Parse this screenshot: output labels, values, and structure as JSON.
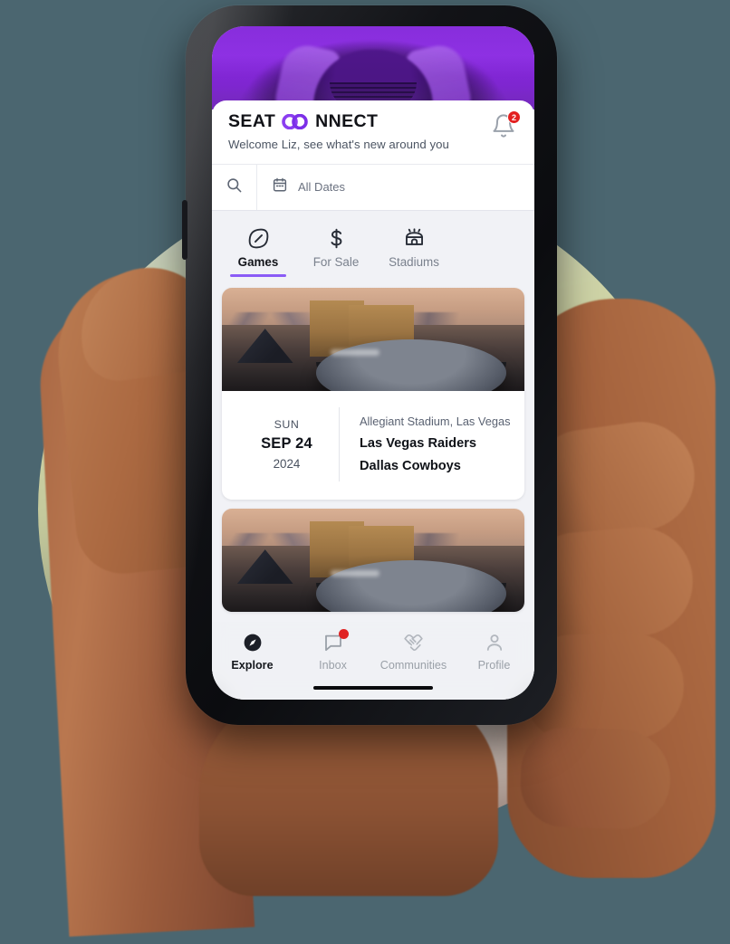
{
  "app": {
    "logo_word1": "SEAT",
    "logo_mark": "infinity-mark",
    "logo_word2": "NNECT",
    "welcome": "Welcome Liz, see what's new around you",
    "accent_purple": "#8b5cf6",
    "badge_red": "#e32020",
    "page_background": "#4b6670"
  },
  "header": {
    "notification_icon": "bell-icon",
    "notification_count": "2"
  },
  "search": {
    "search_icon": "search-icon",
    "calendar_icon": "calendar-icon",
    "date_filter_value": "All Dates",
    "placeholder": "Search"
  },
  "tabs": [
    {
      "label": "Games",
      "icon": "football-icon",
      "active": true
    },
    {
      "label": "For Sale",
      "icon": "dollar-icon",
      "active": false
    },
    {
      "label": "Stadiums",
      "icon": "stadium-icon",
      "active": false
    }
  ],
  "events": [
    {
      "day_of_week": "SUN",
      "month_day": "SEP 24",
      "year": "2024",
      "venue": "Allegiant Stadium, Las Vegas",
      "home_team": "Las Vegas Raiders",
      "away_team": "Dallas Cowboys",
      "image": "allegiant-stadium-aerial"
    },
    {
      "image": "allegiant-stadium-aerial"
    }
  ],
  "bottom_nav": [
    {
      "label": "Explore",
      "icon": "compass-icon",
      "active": true,
      "badge": false
    },
    {
      "label": "Inbox",
      "icon": "chat-icon",
      "active": false,
      "badge": true
    },
    {
      "label": "Communities",
      "icon": "handshake-icon",
      "active": false,
      "badge": false
    },
    {
      "label": "Profile",
      "icon": "person-icon",
      "active": false,
      "badge": false
    }
  ]
}
